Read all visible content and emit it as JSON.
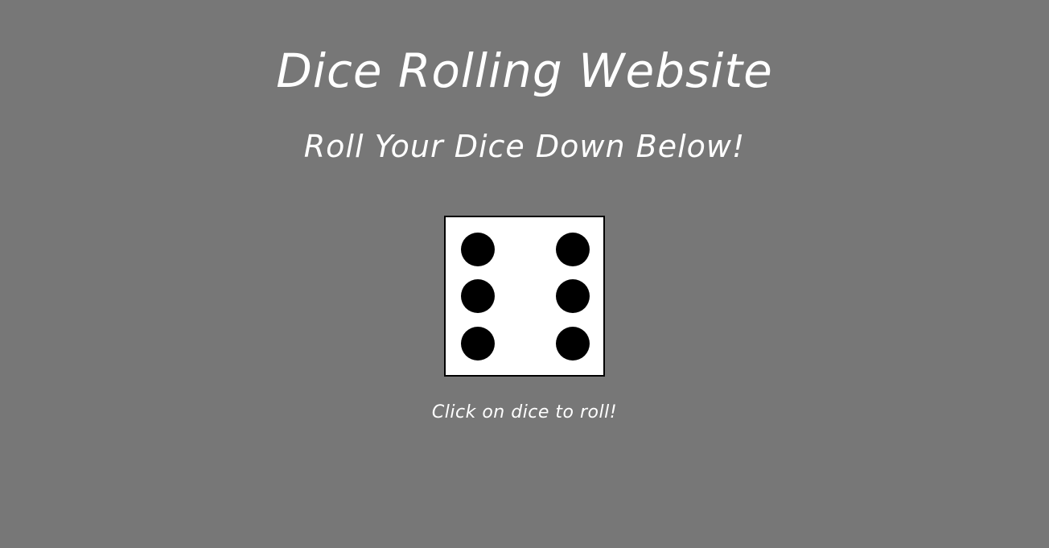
{
  "page": {
    "title": "Dice Rolling Website",
    "subtitle": "Roll Your Dice Down Below!",
    "hint": "Click on dice to roll!",
    "background_color": "#777777"
  },
  "dice": {
    "value": 6,
    "face_color": "#ffffff",
    "pip_color": "#000000"
  }
}
